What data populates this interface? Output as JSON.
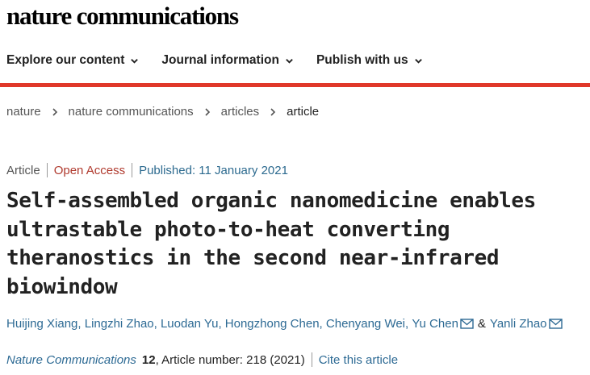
{
  "header": {
    "logo": "nature communications"
  },
  "nav": [
    {
      "label": "Explore our content"
    },
    {
      "label": "Journal information"
    },
    {
      "label": "Publish with us"
    }
  ],
  "breadcrumb": [
    "nature",
    "nature communications",
    "articles",
    "article"
  ],
  "meta": {
    "type": "Article",
    "access": "Open Access",
    "published": "Published: 11 January 2021"
  },
  "title": "Self-assembled organic nanomedicine enables ultrastable photo-to-heat converting theranostics in the second near-infrared biowindow",
  "authors": [
    "Huijing Xiang,",
    "Lingzhi Zhao,",
    "Luodan Yu,",
    "Hongzhong Chen,",
    "Chenyang Wei,",
    "Yu Chen",
    "Yanli Zhao"
  ],
  "authors_amp": "&",
  "citation": {
    "journal": "Nature Communications",
    "volume": "12",
    "details": ", Article number: 218 (2021)",
    "cite_link": "Cite this article"
  },
  "colors": {
    "accent_rule": "#e0382a",
    "link": "#2d6a94",
    "open_access": "#b03a2e"
  },
  "icons": [
    "chevron-down-icon",
    "chevron-right-icon",
    "mail-icon"
  ]
}
